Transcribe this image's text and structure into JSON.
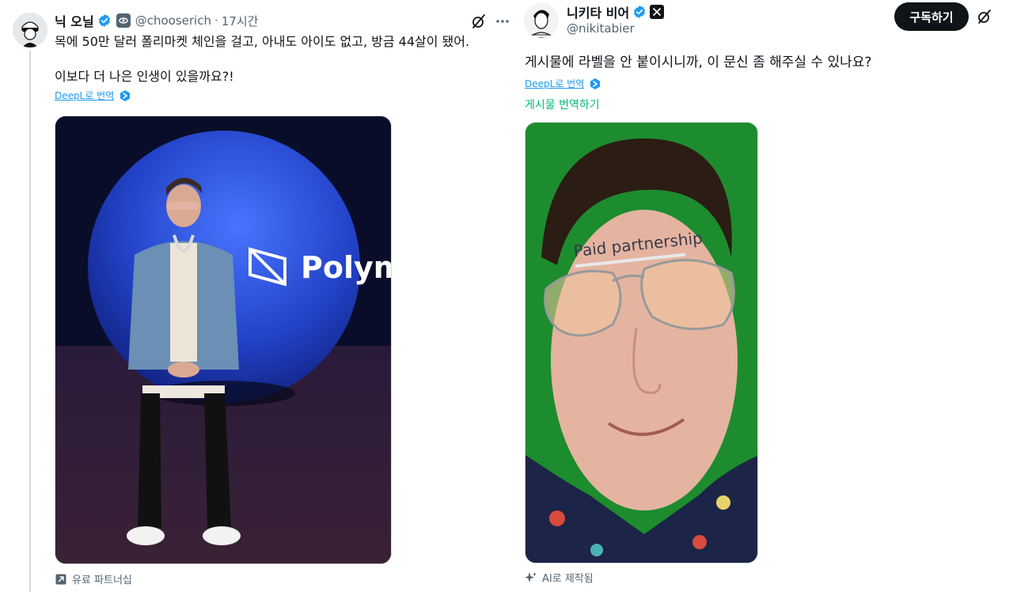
{
  "left_tweet": {
    "name": "닉 오닐",
    "handle": "@chooserich",
    "separator": "·",
    "time": "17시간",
    "text": "목에 50만 달러 폴리마켓 체인을 걸고, 아내도 아이도 없고, 방금 44살이 됐어.\n\n이보다 더 나은 인생이 있을까요?!",
    "translate_label": "DeepL로 번역",
    "media_label": "유료 파트너십",
    "photo_sign_text": "Polym",
    "icons": {
      "verified": "verified-badge-icon",
      "org": "org-badge-icon",
      "grok": "grok-icon",
      "more": "more-icon",
      "deepl": "deepl-icon",
      "partnership": "arrow-up-right-icon"
    },
    "colors": {
      "accent": "#1d9bf0",
      "muted": "#536471",
      "photo_background": "#0a0d2a",
      "globe": "#2a4bd8"
    }
  },
  "right_tweet": {
    "name": "니키타 비어",
    "handle": "@nikitabier",
    "subscribe_label": "구독하기",
    "text": "게시물에 라벨을 안 붙이시니까, 이 문신 좀 해주실 수 있나요?",
    "translate_label": "DeepL로 번역",
    "translate_post_label": "게시물 번역하기",
    "media_label": "AI로 제작됨",
    "forehead_text": "Paid partnership",
    "icons": {
      "verified": "verified-badge-icon",
      "x_affiliate": "x-logo-icon",
      "grok": "grok-icon",
      "deepl": "deepl-icon",
      "ai": "sparkle-icon"
    },
    "colors": {
      "translate_green": "#00ba7c",
      "photo_background": "#1d8c2e",
      "button": "#0f1419"
    }
  }
}
